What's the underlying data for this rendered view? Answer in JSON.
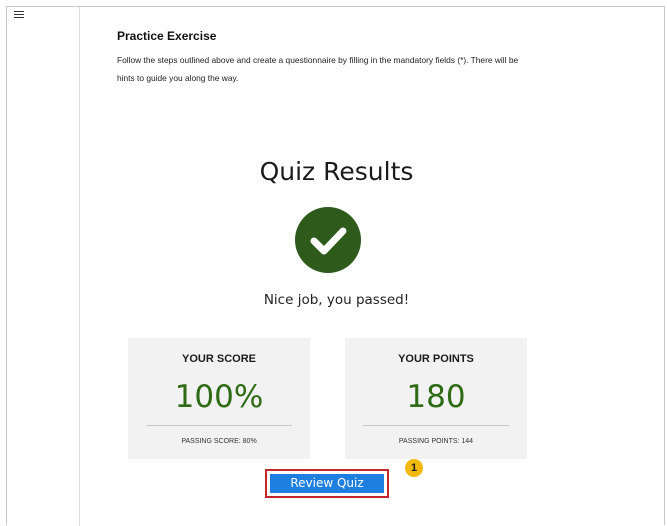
{
  "sidebar": {
    "menu_icon": "hamburger-menu-icon"
  },
  "exercise": {
    "title": "Practice Exercise",
    "description": "Follow the steps outlined above and create a questionnaire by filling in the mandatory fields (*).  There will be hints to guide you along the way."
  },
  "results": {
    "title": "Quiz Results",
    "status_icon": "check-circle-icon",
    "message": "Nice job, you passed!"
  },
  "score": {
    "label": "YOUR SCORE",
    "value": "100%",
    "passing": "PASSING SCORE: 80%"
  },
  "points": {
    "label": "YOUR POINTS",
    "value": "180",
    "passing": "PASSING POINTS: 144"
  },
  "review": {
    "button_label": "Review Quiz",
    "step_badge": "1"
  },
  "colors": {
    "check_circle": "#2e5a1c",
    "value_green": "#2e6b14",
    "button_blue": "#1f7fe0",
    "highlight_red": "#c1272d",
    "badge_yellow": "#f2b90c",
    "card_bg": "#f2f2f2"
  }
}
